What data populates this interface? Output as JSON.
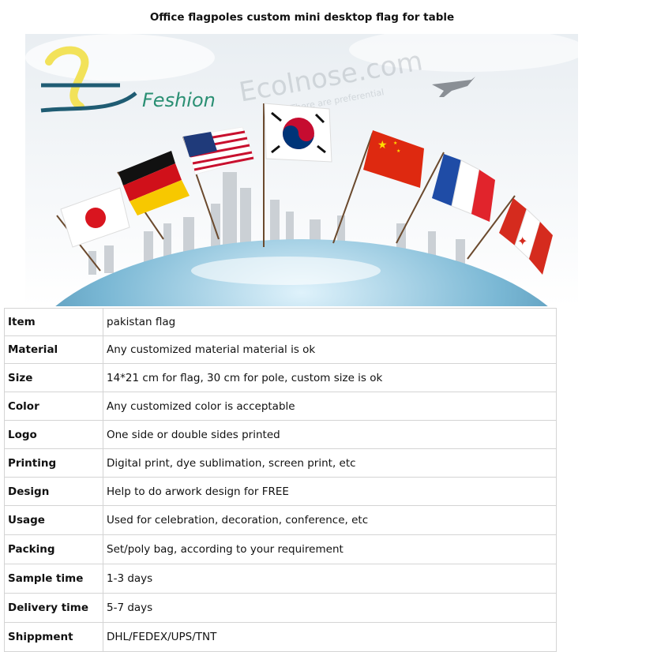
{
  "title": "Office flagpoles custom mini desktop  flag for table",
  "banner": {
    "logo_text": "Feshion",
    "watermark": "Ecolnose.com",
    "watermark_tagline": "There are preferential"
  },
  "specs": [
    {
      "key": "Item",
      "value": "pakistan flag"
    },
    {
      "key": "Material",
      "value": "Any customized material material is ok"
    },
    {
      "key": "Size",
      "value": "14*21 cm for flag, 30 cm for pole, custom size is ok"
    },
    {
      "key": "Color",
      "value": "Any customized color is acceptable"
    },
    {
      "key": "Logo",
      "value": "One side or double sides printed"
    },
    {
      "key": "Printing",
      "value": "Digital print, dye sublimation, screen print, etc"
    },
    {
      "key": "Design",
      "value": "Help to do arwork design for FREE"
    },
    {
      "key": "Usage",
      "value": "Used for celebration, decoration, conference, etc"
    },
    {
      "key": "Packing",
      "value": "Set/poly bag, according to your requirement"
    },
    {
      "key": "Sample time",
      "value": "1-3 days"
    },
    {
      "key": "Delivery time",
      "value": "5-7 days"
    },
    {
      "key": "Shippment",
      "value": "DHL/FEDEX/UPS/TNT"
    }
  ]
}
